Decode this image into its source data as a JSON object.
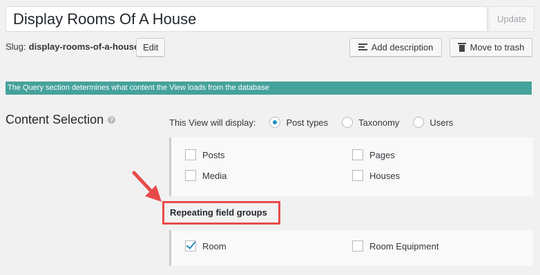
{
  "header": {
    "title_value": "Display Rooms Of A House",
    "update_label": "Update",
    "slug_label": "Slug:",
    "slug_value": "display-rooms-of-a-house",
    "edit_label": "Edit",
    "add_description_label": "Add description",
    "move_to_trash_label": "Move to trash"
  },
  "notice": {
    "text": "The Query section determines what content the View loads from the database"
  },
  "content_selection": {
    "title": "Content Selection",
    "display_label": "This View will display:",
    "options": [
      {
        "label": "Post types",
        "checked": true
      },
      {
        "label": "Taxonomy",
        "checked": false
      },
      {
        "label": "Users",
        "checked": false
      }
    ],
    "post_types": [
      {
        "label": "Posts",
        "checked": false
      },
      {
        "label": "Pages",
        "checked": false
      },
      {
        "label": "Media",
        "checked": false
      },
      {
        "label": "Houses",
        "checked": false
      }
    ],
    "repeating_title": "Repeating field groups",
    "repeating_groups": [
      {
        "label": "Room",
        "checked": true
      },
      {
        "label": "Room Equipment",
        "checked": false
      }
    ]
  },
  "colors": {
    "notice_bg": "#46a29c",
    "highlight": "#e84a4a",
    "accent": "#1e8cbe"
  }
}
